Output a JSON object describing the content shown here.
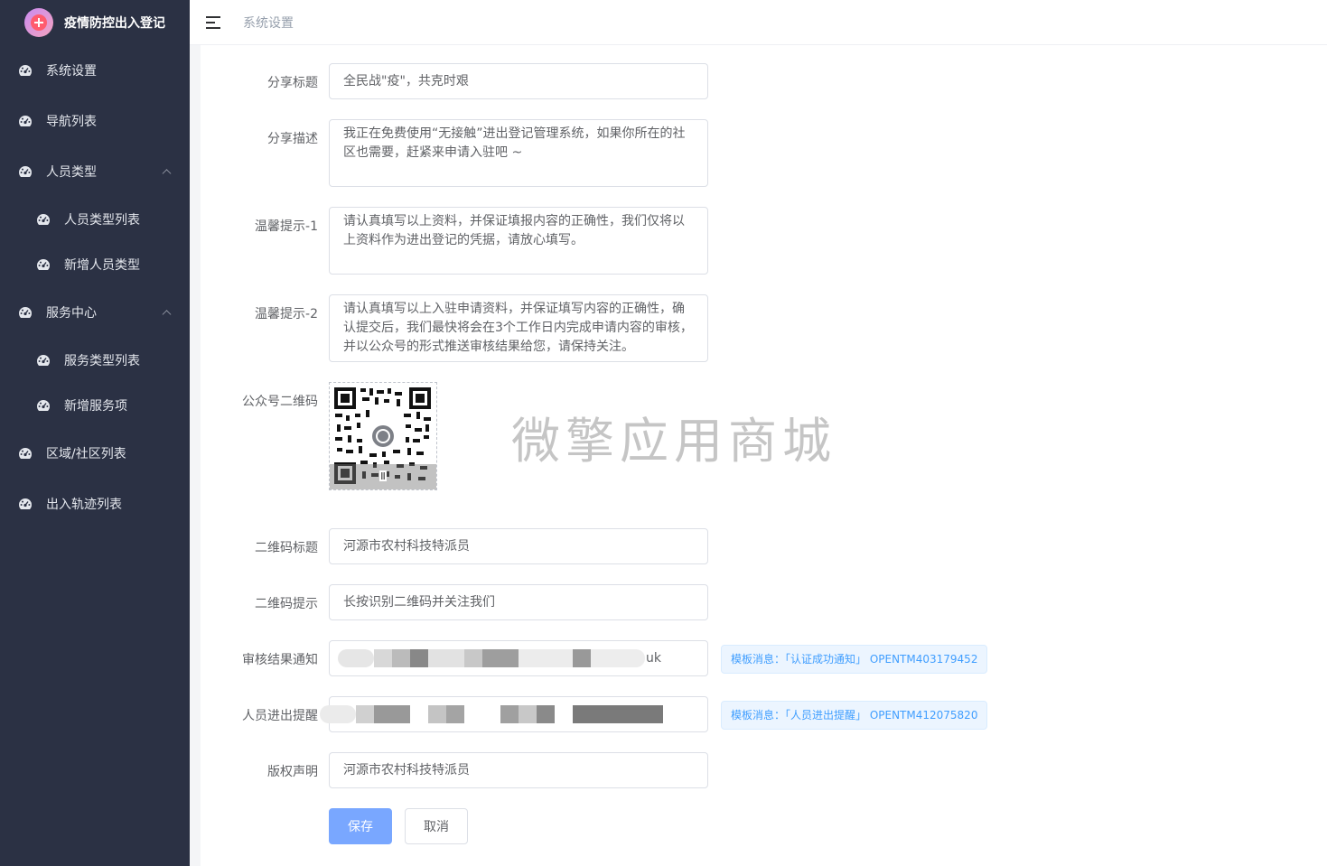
{
  "app": {
    "title": "疫情防控出入登记"
  },
  "header": {
    "breadcrumb": "系统设置"
  },
  "sidebar": {
    "items": [
      {
        "label": "系统设置"
      },
      {
        "label": "导航列表"
      },
      {
        "label": "人员类型"
      },
      {
        "label": "人员类型列表"
      },
      {
        "label": "新增人员类型"
      },
      {
        "label": "服务中心"
      },
      {
        "label": "服务类型列表"
      },
      {
        "label": "新增服务项"
      },
      {
        "label": "区域/社区列表"
      },
      {
        "label": "出入轨迹列表"
      }
    ]
  },
  "form": {
    "share_title": {
      "label": "分享标题",
      "value": "全民战\"疫\"，共克时艰"
    },
    "share_desc": {
      "label": "分享描述",
      "value": "我正在免费使用“无接触”进出登记管理系统，如果你所在的社区也需要，赶紧来申请入驻吧 ~"
    },
    "tip1": {
      "label": "温馨提示-1",
      "value": "请认真填写以上资料，并保证填报内容的正确性，我们仅将以上资料作为进出登记的凭据，请放心填写。"
    },
    "tip2": {
      "label": "温馨提示-2",
      "value": "请认真填写以上入驻申请资料，并保证填写内容的正确性，确认提交后，我们最快将会在3个工作日内完成申请内容的审核，并以公众号的形式推送审核结果给您，请保持关注。"
    },
    "qrcode": {
      "label": "公众号二维码"
    },
    "qr_title": {
      "label": "二维码标题",
      "value": "河源市农村科技特派员"
    },
    "qr_tip": {
      "label": "二维码提示",
      "value": "长按识别二维码并关注我们"
    },
    "audit_notice": {
      "label": "审核结果通知",
      "value_suffix": "uk",
      "tag": "模板消息：「认证成功通知」 OPENTM403179452"
    },
    "inout_remind": {
      "label": "人员进出提醒",
      "tag": "模板消息：「人员进出提醒」 OPENTM412075820"
    },
    "copyright": {
      "label": "版权声明",
      "value": "河源市农村科技特派员"
    }
  },
  "buttons": {
    "save": "保存",
    "cancel": "取消"
  },
  "watermark": "微擎应用商城",
  "colors": {
    "sidebar_bg": "#2b3144",
    "primary": "#79a7ff",
    "tag_text": "#409eff"
  }
}
